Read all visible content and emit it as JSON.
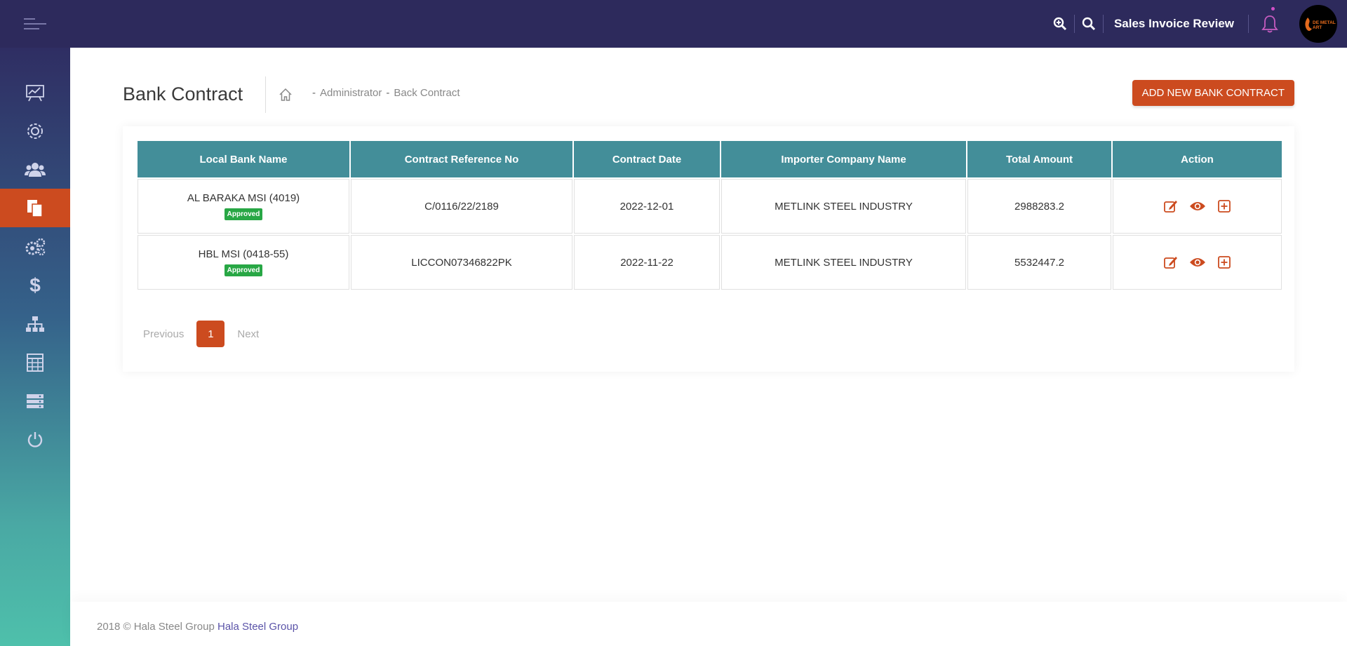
{
  "header": {
    "title": "Sales Invoice Review",
    "avatar_text": "DE METAL ART"
  },
  "sidebar": {
    "items": [
      {
        "icon": "chart-icon",
        "active": false
      },
      {
        "icon": "settings-icon",
        "active": false
      },
      {
        "icon": "users-icon",
        "active": false
      },
      {
        "icon": "documents-icon",
        "active": true
      },
      {
        "icon": "gears-icon",
        "active": false
      },
      {
        "icon": "dollar-icon",
        "active": false
      },
      {
        "icon": "sitemap-icon",
        "active": false
      },
      {
        "icon": "calculator-icon",
        "active": false
      },
      {
        "icon": "server-icon",
        "active": false
      },
      {
        "icon": "power-icon",
        "active": false
      }
    ]
  },
  "page": {
    "title": "Bank Contract",
    "breadcrumb": [
      "Administrator",
      "Back Contract"
    ],
    "add_button": "ADD NEW BANK CONTRACT"
  },
  "table": {
    "columns": [
      "Local Bank Name",
      "Contract Reference No",
      "Contract Date",
      "Importer Company Name",
      "Total Amount",
      "Action"
    ],
    "rows": [
      {
        "bank": "AL BARAKA MSI (4019)",
        "status": "Approved",
        "ref": "C/0116/22/2189",
        "date": "2022-12-01",
        "importer": "METLINK STEEL INDUSTRY",
        "amount": "2988283.2"
      },
      {
        "bank": "HBL MSI (0418-55)",
        "status": "Approved",
        "ref": "LICCON07346822PK",
        "date": "2022-11-22",
        "importer": "METLINK STEEL INDUSTRY",
        "amount": "5532447.2"
      }
    ]
  },
  "pagination": {
    "prev": "Previous",
    "current": "1",
    "next": "Next"
  },
  "footer": {
    "text": "2018 © Hala Steel Group",
    "link": "Hala Steel Group"
  },
  "colors": {
    "topbar": "#2d2a5c",
    "accent": "#cc4b1f",
    "table_header": "#438e99",
    "badge": "#28a745"
  }
}
